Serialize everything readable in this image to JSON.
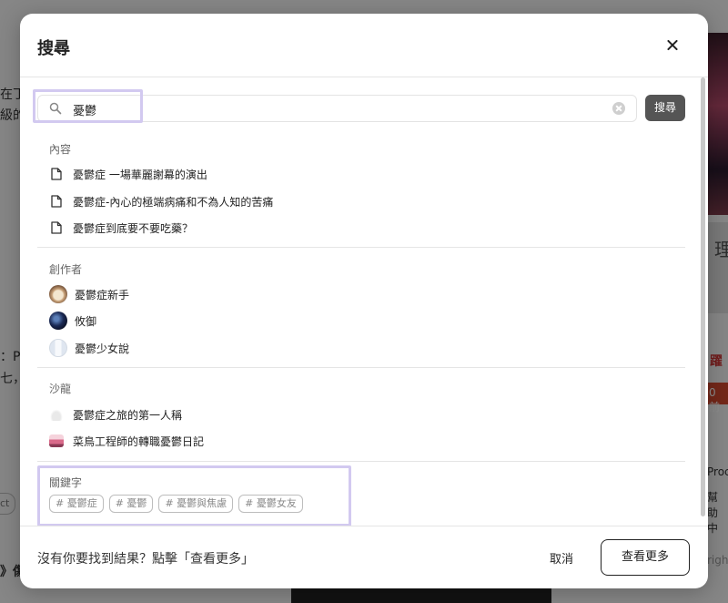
{
  "background": {
    "left_fragments": [
      "在丁",
      "級的",
      "：Pl",
      "七，",
      "ct",
      "》傷"
    ],
    "right_fragments": [
      "理",
      "躍",
      "0 前",
      "Proc",
      "幫助中",
      "righ"
    ]
  },
  "modal": {
    "title": "搜尋",
    "search": {
      "value": "憂鬱",
      "button_label": "搜尋"
    },
    "sections": {
      "content": {
        "label": "內容",
        "items": [
          "憂鬱症 一場華麗謝幕的演出",
          "憂鬱症-內心的極端病痛和不為人知的苦痛",
          "憂鬱症到底要不要吃藥？"
        ]
      },
      "creators": {
        "label": "創作者",
        "items": [
          "憂鬱症新手",
          "攸御",
          "憂鬱少女說"
        ]
      },
      "salons": {
        "label": "沙龍",
        "items": [
          "憂鬱症之旅的第一人稱",
          "菜鳥工程師的轉職憂鬱日記"
        ]
      },
      "keywords": {
        "label": "關鍵字",
        "tags": [
          "# 憂鬱症",
          "# 憂鬱",
          "# 憂鬱與焦慮",
          "# 憂鬱女友"
        ]
      }
    },
    "footer": {
      "prompt": "沒有你要找到結果？點擊「查看更多」",
      "cancel_label": "取消",
      "more_label": "查看更多"
    }
  },
  "colors": {
    "highlight": "#d2c9f0",
    "search_button": "#555555"
  }
}
